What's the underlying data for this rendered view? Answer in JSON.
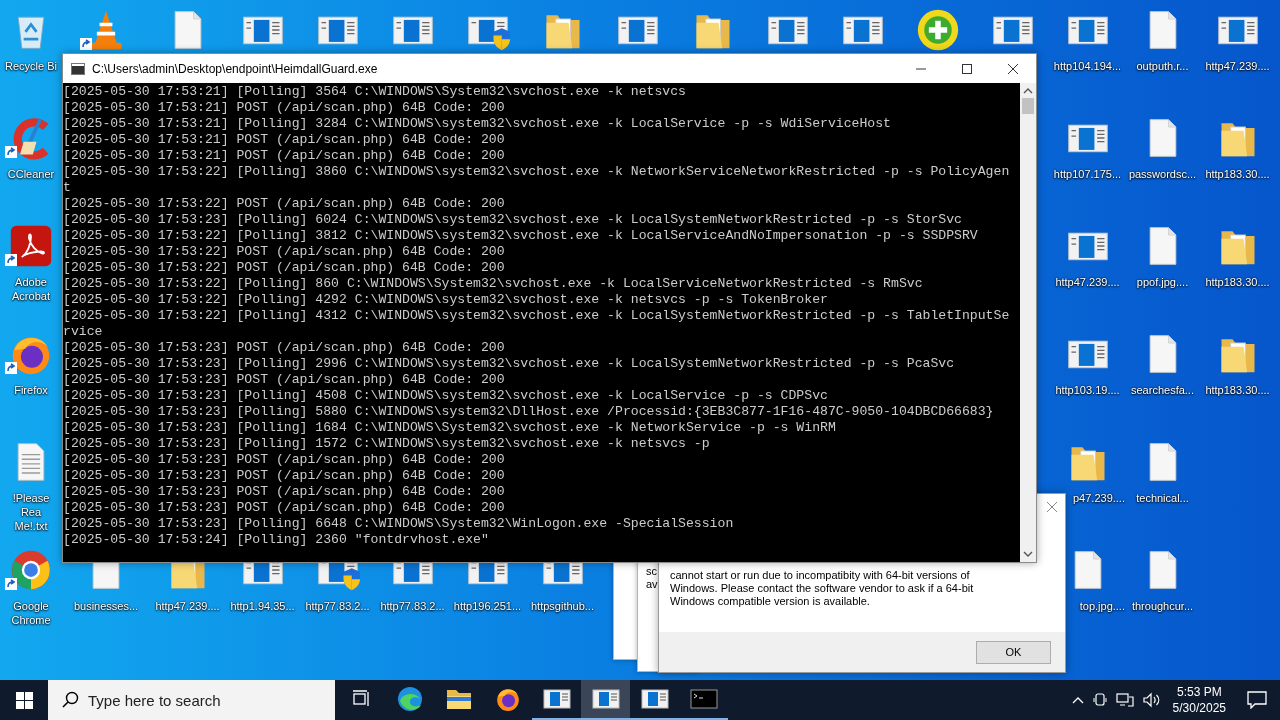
{
  "desktop_icons": [
    {
      "kind": "recycle-bin",
      "label": "Recycle Bi"
    },
    {
      "kind": "cone",
      "shortcut": true
    },
    {
      "kind": "document"
    },
    {
      "kind": "app"
    },
    {
      "kind": "app"
    },
    {
      "kind": "app"
    },
    {
      "kind": "app-shield"
    },
    {
      "kind": "folder"
    },
    {
      "kind": "app"
    },
    {
      "kind": "folder"
    },
    {
      "kind": "app"
    },
    {
      "kind": "app"
    },
    {
      "kind": "plus"
    },
    {
      "kind": "app"
    },
    {
      "kind": "app",
      "label": "http104.194..."
    },
    {
      "kind": "document",
      "label": "outputh.r..."
    },
    {
      "kind": "app",
      "label": "http47.239...."
    },
    {
      "kind": "brush",
      "label": "CCleaner",
      "shortcut": true
    },
    {
      "kind": "app",
      "label": "http107.175..."
    },
    {
      "kind": "document",
      "label": "passwordsc..."
    },
    {
      "kind": "folder",
      "label": "http183.30...."
    },
    {
      "kind": "pdf",
      "label": "Adobe Acrobat",
      "shortcut": true
    },
    {
      "kind": "app",
      "label": "http47.239...."
    },
    {
      "kind": "document",
      "label": "ppof.jpg...."
    },
    {
      "kind": "folder",
      "label": "http183.30...."
    },
    {
      "kind": "firefox",
      "label": "Firefox",
      "shortcut": true
    },
    {
      "kind": "app",
      "label": "http103.19...."
    },
    {
      "kind": "document",
      "label": "searchesfa..."
    },
    {
      "kind": "folder",
      "label": "http183.30...."
    },
    {
      "kind": "text",
      "label": "!Please Rea\nMe!.txt"
    },
    {
      "kind": "folder",
      "label": "p47.239...."
    },
    {
      "kind": "document",
      "label": "technical..."
    },
    {
      "kind": "chrome",
      "label": "Google Chrome",
      "shortcut": true
    },
    {
      "kind": "document",
      "label": "businesses..."
    },
    {
      "kind": "folder",
      "label": "http47.239...."
    },
    {
      "kind": "app",
      "label": "http1.94.35..."
    },
    {
      "kind": "app-shield",
      "label": "http77.83.2..."
    },
    {
      "kind": "app",
      "label": "http77.83.2..."
    },
    {
      "kind": "app",
      "label": "http196.251..."
    },
    {
      "kind": "app",
      "label": "httpsgithub..."
    },
    {
      "kind": "document",
      "label": "top.jpg...."
    },
    {
      "kind": "document",
      "label": "throughcur..."
    }
  ],
  "console_window": {
    "title": "C:\\Users\\admin\\Desktop\\endpoint\\HeimdallGuard.exe",
    "lines": [
      "[2025-05-30 17:53:21] [Polling] 3564 C:\\WINDOWS\\System32\\svchost.exe -k netsvcs",
      "[2025-05-30 17:53:21] POST (/api/scan.php) 64B Code: 200",
      "[2025-05-30 17:53:21] [Polling] 3284 C:\\WINDOWS\\system32\\svchost.exe -k LocalService -p -s WdiServiceHost",
      "[2025-05-30 17:53:21] POST (/api/scan.php) 64B Code: 200",
      "[2025-05-30 17:53:21] POST (/api/scan.php) 64B Code: 200",
      "[2025-05-30 17:53:22] [Polling] 3860 C:\\WINDOWS\\system32\\svchost.exe -k NetworkServiceNetworkRestricted -p -s PolicyAgent",
      "[2025-05-30 17:53:22] POST (/api/scan.php) 64B Code: 200",
      "[2025-05-30 17:53:23] [Polling] 6024 C:\\WINDOWS\\system32\\svchost.exe -k LocalSystemNetworkRestricted -p -s StorSvc",
      "[2025-05-30 17:53:22] [Polling] 3812 C:\\WINDOWS\\system32\\svchost.exe -k LocalServiceAndNoImpersonation -p -s SSDPSRV",
      "[2025-05-30 17:53:22] POST (/api/scan.php) 64B Code: 200",
      "[2025-05-30 17:53:22] POST (/api/scan.php) 64B Code: 200",
      "[2025-05-30 17:53:22] [Polling] 860 C:\\WINDOWS\\System32\\svchost.exe -k LocalServiceNetworkRestricted -s RmSvc",
      "[2025-05-30 17:53:22] [Polling] 4292 C:\\WINDOWS\\system32\\svchost.exe -k netsvcs -p -s TokenBroker",
      "[2025-05-30 17:53:22] [Polling] 4312 C:\\WINDOWS\\system32\\svchost.exe -k LocalSystemNetworkRestricted -p -s TabletInputService",
      "[2025-05-30 17:53:23] POST (/api/scan.php) 64B Code: 200",
      "[2025-05-30 17:53:23] [Polling] 2996 C:\\WINDOWS\\system32\\svchost.exe -k LocalSystemNetworkRestricted -p -s PcaSvc",
      "[2025-05-30 17:53:23] POST (/api/scan.php) 64B Code: 200",
      "[2025-05-30 17:53:23] [Polling] 4508 C:\\WINDOWS\\system32\\svchost.exe -k LocalService -p -s CDPSvc",
      "[2025-05-30 17:53:23] [Polling] 5880 C:\\WINDOWS\\system32\\DllHost.exe /Processid:{3EB3C877-1F16-487C-9050-104DBCD66683}",
      "[2025-05-30 17:53:23] [Polling] 1684 C:\\WINDOWS\\System32\\svchost.exe -k NetworkService -p -s WinRM",
      "[2025-05-30 17:53:23] [Polling] 1572 C:\\WINDOWS\\system32\\svchost.exe -k netsvcs -p",
      "[2025-05-30 17:53:23] POST (/api/scan.php) 64B Code: 200",
      "[2025-05-30 17:53:23] POST (/api/scan.php) 64B Code: 200",
      "[2025-05-30 17:53:23] POST (/api/scan.php) 64B Code: 200",
      "[2025-05-30 17:53:23] POST (/api/scan.php) 64B Code: 200",
      "[2025-05-30 17:53:23] [Polling] 6648 C:\\WINDOWS\\System32\\WinLogon.exe -SpecialSession",
      "[2025-05-30 17:53:24] [Polling] 2360 \"fontdrvhost.exe\""
    ]
  },
  "background_dialogs": [
    {
      "kind": "blank"
    },
    {
      "kind": "text",
      "fragments": [
        "sc",
        "av"
      ]
    }
  ],
  "dialog": {
    "message": "cannot start or run due to incompatibity with 64-bit versions of Windows. Please contact the software vendor to ask if a 64-bit Windows compatible version is available.",
    "ok_button": "OK"
  },
  "taskbar": {
    "search_placeholder": "Type here to search",
    "apps": [
      {
        "kind": "task-view",
        "running": false,
        "selected": false
      },
      {
        "kind": "edge",
        "running": false,
        "selected": false
      },
      {
        "kind": "explorer",
        "running": false,
        "selected": false
      },
      {
        "kind": "firefox",
        "running": false,
        "selected": false
      },
      {
        "kind": "app",
        "running": true,
        "selected": false
      },
      {
        "kind": "app",
        "running": true,
        "selected": true
      },
      {
        "kind": "app",
        "running": true,
        "selected": false
      },
      {
        "kind": "terminal",
        "running": true,
        "selected": false
      }
    ],
    "clock": {
      "time": "5:53 PM",
      "date": "5/30/2025"
    }
  }
}
